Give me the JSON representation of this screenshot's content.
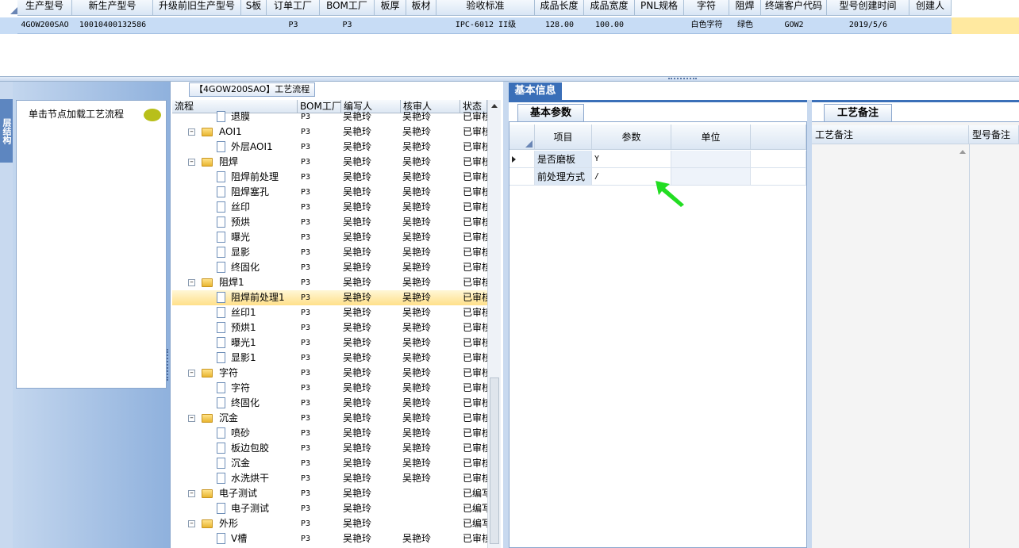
{
  "top_grid": {
    "columns": [
      "生产型号",
      "新生产型号",
      "升级前旧生产型号",
      "S板",
      "订单工厂",
      "BOM工厂",
      "板厚",
      "板材",
      "验收标准",
      "成品长度",
      "成品宽度",
      "PNL规格",
      "字符",
      "阻焊",
      "终端客户代码",
      "型号创建时间",
      "创建人"
    ],
    "row": [
      "4GOW200SAO",
      "10010400132586",
      "",
      "",
      "P3",
      "P3",
      "",
      "",
      "IPC-6012 II级",
      "128.00",
      "100.00",
      "",
      "白色字符",
      "绿色",
      "GOW2",
      "2019/5/6",
      ""
    ]
  },
  "left_panel": {
    "vertical_tab": "层结构",
    "hint": "单击节点加载工艺流程"
  },
  "tree": {
    "title": "【4GOW200SAO】工艺流程",
    "columns": [
      "流程",
      "BOM工厂",
      "编写人",
      "核审人",
      "状态"
    ],
    "rows": [
      {
        "level": 2,
        "kind": "doc",
        "name": "退膜",
        "bom": "P3",
        "writer": "吴艳玲",
        "reviewer": "吴艳玲",
        "status": "已审核"
      },
      {
        "level": 1,
        "kind": "folder",
        "name": "AOI1",
        "bom": "P3",
        "writer": "吴艳玲",
        "reviewer": "吴艳玲",
        "status": "已审核"
      },
      {
        "level": 2,
        "kind": "doc",
        "name": "外层AOI1",
        "bom": "P3",
        "writer": "吴艳玲",
        "reviewer": "吴艳玲",
        "status": "已审核"
      },
      {
        "level": 1,
        "kind": "folder",
        "name": "阻焊",
        "bom": "P3",
        "writer": "吴艳玲",
        "reviewer": "吴艳玲",
        "status": "已审核"
      },
      {
        "level": 2,
        "kind": "doc",
        "name": "阻焊前处理",
        "bom": "P3",
        "writer": "吴艳玲",
        "reviewer": "吴艳玲",
        "status": "已审核"
      },
      {
        "level": 2,
        "kind": "doc",
        "name": "阻焊塞孔",
        "bom": "P3",
        "writer": "吴艳玲",
        "reviewer": "吴艳玲",
        "status": "已审核"
      },
      {
        "level": 2,
        "kind": "doc",
        "name": "丝印",
        "bom": "P3",
        "writer": "吴艳玲",
        "reviewer": "吴艳玲",
        "status": "已审核"
      },
      {
        "level": 2,
        "kind": "doc",
        "name": "预烘",
        "bom": "P3",
        "writer": "吴艳玲",
        "reviewer": "吴艳玲",
        "status": "已审核"
      },
      {
        "level": 2,
        "kind": "doc",
        "name": "曝光",
        "bom": "P3",
        "writer": "吴艳玲",
        "reviewer": "吴艳玲",
        "status": "已审核"
      },
      {
        "level": 2,
        "kind": "doc",
        "name": "显影",
        "bom": "P3",
        "writer": "吴艳玲",
        "reviewer": "吴艳玲",
        "status": "已审核"
      },
      {
        "level": 2,
        "kind": "doc",
        "name": "终固化",
        "bom": "P3",
        "writer": "吴艳玲",
        "reviewer": "吴艳玲",
        "status": "已审核"
      },
      {
        "level": 1,
        "kind": "folder",
        "name": "阻焊1",
        "bom": "P3",
        "writer": "吴艳玲",
        "reviewer": "吴艳玲",
        "status": "已审核"
      },
      {
        "level": 2,
        "kind": "doc",
        "name": "阻焊前处理1",
        "bom": "P3",
        "writer": "吴艳玲",
        "reviewer": "吴艳玲",
        "status": "已审核",
        "selected": true
      },
      {
        "level": 2,
        "kind": "doc",
        "name": "丝印1",
        "bom": "P3",
        "writer": "吴艳玲",
        "reviewer": "吴艳玲",
        "status": "已审核"
      },
      {
        "level": 2,
        "kind": "doc",
        "name": "预烘1",
        "bom": "P3",
        "writer": "吴艳玲",
        "reviewer": "吴艳玲",
        "status": "已审核"
      },
      {
        "level": 2,
        "kind": "doc",
        "name": "曝光1",
        "bom": "P3",
        "writer": "吴艳玲",
        "reviewer": "吴艳玲",
        "status": "已审核"
      },
      {
        "level": 2,
        "kind": "doc",
        "name": "显影1",
        "bom": "P3",
        "writer": "吴艳玲",
        "reviewer": "吴艳玲",
        "status": "已审核"
      },
      {
        "level": 1,
        "kind": "folder",
        "name": "字符",
        "bom": "P3",
        "writer": "吴艳玲",
        "reviewer": "吴艳玲",
        "status": "已审核"
      },
      {
        "level": 2,
        "kind": "doc",
        "name": "字符",
        "bom": "P3",
        "writer": "吴艳玲",
        "reviewer": "吴艳玲",
        "status": "已审核"
      },
      {
        "level": 2,
        "kind": "doc",
        "name": "终固化",
        "bom": "P3",
        "writer": "吴艳玲",
        "reviewer": "吴艳玲",
        "status": "已审核"
      },
      {
        "level": 1,
        "kind": "folder",
        "name": "沉金",
        "bom": "P3",
        "writer": "吴艳玲",
        "reviewer": "吴艳玲",
        "status": "已审核"
      },
      {
        "level": 2,
        "kind": "doc",
        "name": "喷砂",
        "bom": "P3",
        "writer": "吴艳玲",
        "reviewer": "吴艳玲",
        "status": "已审核"
      },
      {
        "level": 2,
        "kind": "doc",
        "name": "板边包胶",
        "bom": "P3",
        "writer": "吴艳玲",
        "reviewer": "吴艳玲",
        "status": "已审核"
      },
      {
        "level": 2,
        "kind": "doc",
        "name": "沉金",
        "bom": "P3",
        "writer": "吴艳玲",
        "reviewer": "吴艳玲",
        "status": "已审核"
      },
      {
        "level": 2,
        "kind": "doc",
        "name": "水洗烘干",
        "bom": "P3",
        "writer": "吴艳玲",
        "reviewer": "吴艳玲",
        "status": "已审核"
      },
      {
        "level": 1,
        "kind": "folder",
        "name": "电子测试",
        "bom": "P3",
        "writer": "吴艳玲",
        "reviewer": "",
        "status": "已编写"
      },
      {
        "level": 2,
        "kind": "doc",
        "name": "电子测试",
        "bom": "P3",
        "writer": "吴艳玲",
        "reviewer": "",
        "status": "已编写"
      },
      {
        "level": 1,
        "kind": "folder",
        "name": "外形",
        "bom": "P3",
        "writer": "吴艳玲",
        "reviewer": "",
        "status": "已编写"
      },
      {
        "level": 2,
        "kind": "doc",
        "name": "V槽",
        "bom": "P3",
        "writer": "吴艳玲",
        "reviewer": "吴艳玲",
        "status": "已审核"
      }
    ]
  },
  "basic_info": {
    "tab": "基本信息",
    "subtab": "基本参数",
    "columns": [
      "项目",
      "参数",
      "单位"
    ],
    "rows": [
      {
        "item": "是否磨板",
        "param": "Y",
        "unit": ""
      },
      {
        "item": "前处理方式",
        "param": "/",
        "unit": ""
      }
    ]
  },
  "notes": {
    "tab": "工艺备注",
    "columns": [
      "工艺备注",
      "型号备注"
    ]
  },
  "colors": {
    "accent": "#3a6fb8",
    "selection": "#ffe08a",
    "grid_selection": "#c7dcf5",
    "pointer": "#22dd22"
  }
}
